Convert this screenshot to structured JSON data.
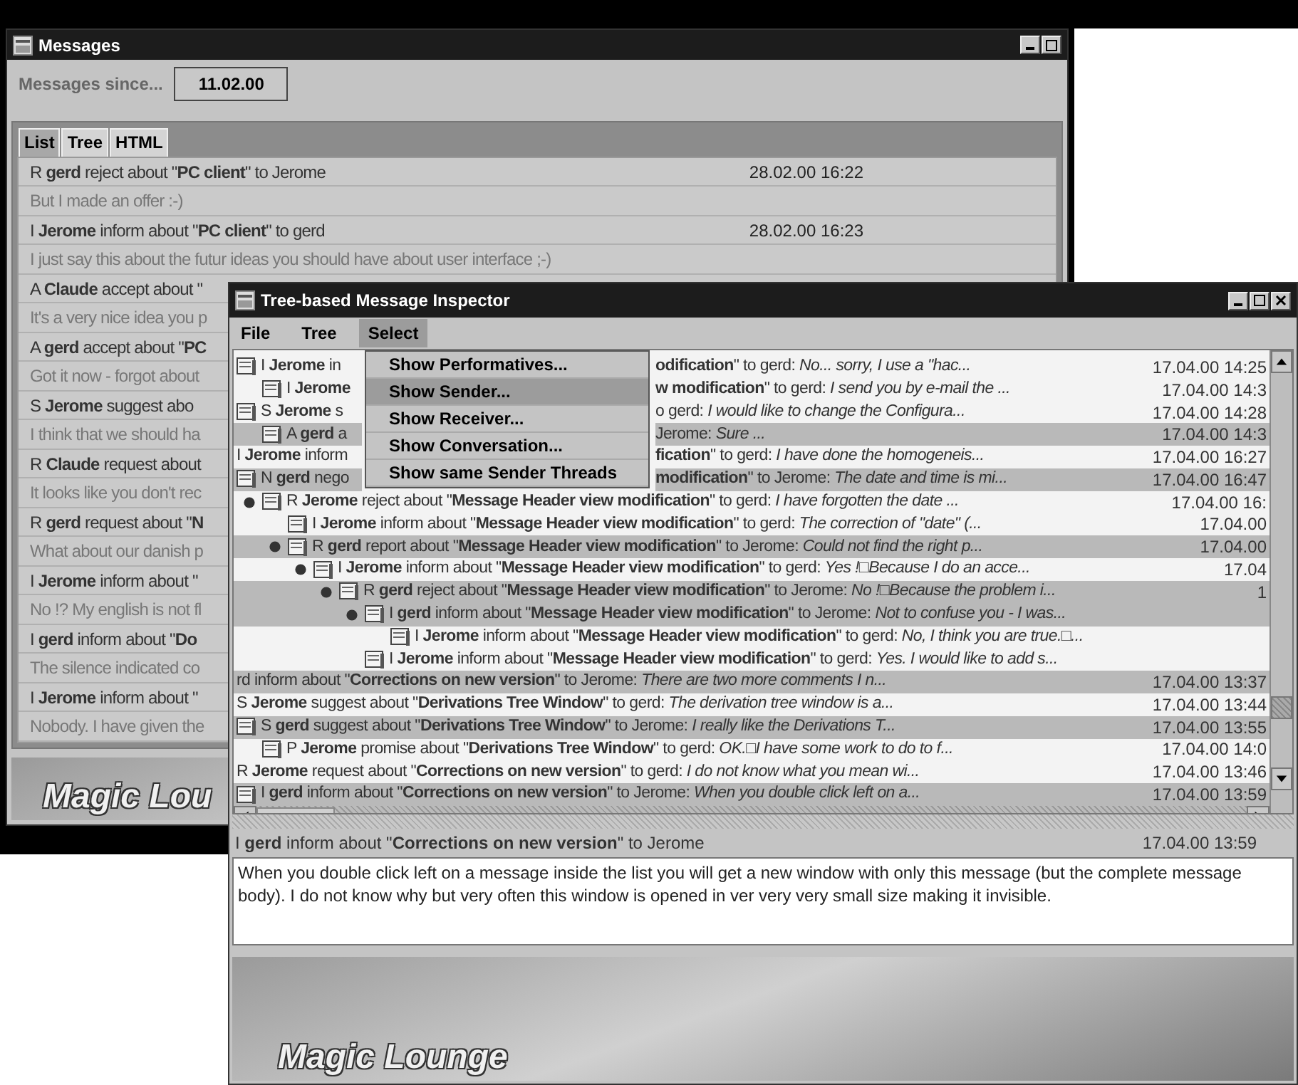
{
  "messages_window": {
    "title": "Messages",
    "since_label": "Messages since...",
    "since_value": "11.02.00",
    "tabs": [
      {
        "label": "List",
        "selected": true
      },
      {
        "label": "Tree",
        "selected": false
      },
      {
        "label": "HTML",
        "selected": false
      }
    ],
    "messages": [
      {
        "header": "R **gerd** reject about \"**PC client**\" to Jerome",
        "date": "28.02.00 16:22",
        "body": "But I made an offer :-)"
      },
      {
        "header": "I **Jerome** inform about \"**PC client**\" to gerd",
        "date": "28.02.00 16:23",
        "body": "I just say this about the futur ideas you should have about user interface ;-)"
      },
      {
        "header": "A **Claude** accept about \"",
        "body": "It's a very nice idea you p"
      },
      {
        "header": "A **gerd** accept about \"**PC**",
        "body": "Got it now - forgot about"
      },
      {
        "header": "S **Jerome** suggest abo",
        "body": "I think that we should ha"
      },
      {
        "header": "R **Claude** request about",
        "body": "It looks like you don't rec"
      },
      {
        "header": "R **gerd** request about \"**N**",
        "body": "What about our danish p"
      },
      {
        "header": "I **Jerome** inform about \"",
        "body": "No !? My english is not fl"
      },
      {
        "header": "I **gerd** inform about \"**Do**",
        "body": "The silence indicated co"
      },
      {
        "header": "I **Jerome** inform about \"",
        "body": "Nobody. I have given the"
      }
    ],
    "banner": "Magic Lou"
  },
  "inspector_window": {
    "title": "Tree-based Message Inspector",
    "menu": [
      {
        "label": "File",
        "selected": false
      },
      {
        "label": "Tree",
        "selected": false
      },
      {
        "label": "Select",
        "selected": true
      }
    ],
    "dropdown": [
      {
        "label": "Show Performatives...",
        "selected": false
      },
      {
        "label": "Show Sender...",
        "selected": true
      },
      {
        "label": "Show Receiver...",
        "selected": false
      },
      {
        "label": "Show Conversation...",
        "selected": false
      },
      {
        "label": "Show same Sender Threads",
        "selected": false
      }
    ],
    "tree": [
      {
        "text": "I **Jerome** in",
        "end": "**odification**\" to gerd: *No... sorry, I use a \"hac...*",
        "date": "17.04.00 14:25",
        "icon": true,
        "expanded": false,
        "highlighted": false,
        "children": [
          {
            "text": "I **Jerome**",
            "end": "**w modification**\" to gerd: *I send you by e-mail the ...*",
            "date": "17.04.00 14:3",
            "icon": true,
            "expanded": false,
            "highlighted": false
          }
        ]
      },
      {
        "text": "S **Jerome** s",
        "end": "o gerd: *I would like to change the Configura...*",
        "date": "17.04.00 14:28",
        "icon": true,
        "expanded": false,
        "highlighted": false,
        "children": [
          {
            "text": "A **gerd** a",
            "end": "Jerome: *Sure ...*",
            "date": "17.04.00 14:3",
            "icon": true,
            "expanded": false,
            "highlighted": true
          }
        ]
      },
      {
        "text": "I **Jerome** inform",
        "end": "**fication**\" to gerd: *I have done the homogeneis...*",
        "date": "17.04.00 16:27",
        "icon": false,
        "expanded": false,
        "highlighted": false
      },
      {
        "text": "N **gerd** nego",
        "end": "**modification**\" to Jerome: *The date and time is mi...*",
        "date": "17.04.00 16:47",
        "icon": true,
        "expanded": false,
        "highlighted": true,
        "children": [
          {
            "text": "R **Jerome** reject about \"**Message Header view modification**\" to gerd: *I have forgotten the date ...*",
            "date": "17.04.00 16:",
            "icon": true,
            "expanded": true,
            "highlighted": false,
            "children": [
              {
                "text": "I **Jerome** inform about \"**Message Header view modification**\" to gerd: *The correction of \"date\" (...*",
                "date": "17.04.00",
                "icon": true,
                "expanded": false,
                "highlighted": false
              },
              {
                "text": "R **gerd** report about \"**Message Header view modification**\" to Jerome: *Could not find the right p...*",
                "date": "17.04.00",
                "icon": true,
                "expanded": true,
                "highlighted": true,
                "children": [
                  {
                    "text": "I **Jerome** inform about \"**Message Header view modification**\" to gerd: *Yes !□Because I do an acce...*",
                    "date": "17.04",
                    "icon": true,
                    "expanded": true,
                    "highlighted": false,
                    "children": [
                      {
                        "text": "R **gerd** reject about \"**Message Header view modification**\" to Jerome: *No !□Because the problem i...*",
                        "date": "1",
                        "icon": true,
                        "expanded": true,
                        "highlighted": true,
                        "children": [
                          {
                            "text": "I **gerd** inform about \"**Message Header view modification**\" to Jerome: *Not to confuse you - I was...*",
                            "icon": true,
                            "expanded": true,
                            "highlighted": true,
                            "children": [
                              {
                                "text": "I **Jerome** inform about \"**Message Header view modification**\" to gerd: *No, I think you are true.□...*",
                                "icon": true,
                                "expanded": false,
                                "highlighted": false
                              }
                            ]
                          },
                          {
                            "text": "I **Jerome** inform about \"**Message Header view modification**\" to gerd: *Yes. I would like to add s...*",
                            "icon": true,
                            "expanded": false,
                            "highlighted": false
                          }
                        ]
                      }
                    ]
                  }
                ]
              }
            ]
          }
        ]
      },
      {
        "text": "rd inform about \"**Corrections on new version**\" to Jerome: *There are two more comments I n...*",
        "date": "17.04.00 13:37",
        "icon": false,
        "expanded": false,
        "highlighted": true
      },
      {
        "text": "S **Jerome** suggest about \"**Derivations Tree Window**\" to gerd: *The derivation tree window is a...*",
        "date": "17.04.00 13:44",
        "icon": false,
        "expanded": false,
        "highlighted": false
      },
      {
        "text": "S **gerd** suggest about \"**Derivations Tree Window**\" to Jerome: *I really like the Derivations T...*",
        "date": "17.04.00 13:55",
        "icon": true,
        "expanded": false,
        "highlighted": true,
        "children": [
          {
            "text": "P **Jerome** promise about \"**Derivations Tree Window**\" to gerd: *OK.□I have some work to do to f...*",
            "date": "17.04.00 14:0",
            "icon": true,
            "expanded": false,
            "highlighted": false
          }
        ]
      },
      {
        "text": "R **Jerome** request about \"**Corrections on new version**\" to gerd: *I do not know what you mean wi...*",
        "date": "17.04.00 13:46",
        "icon": false,
        "expanded": false,
        "highlighted": false
      },
      {
        "text": "I **gerd** inform about \"**Corrections on new version**\" to Jerome: *When you double click left on a...*",
        "date": "17.04.00 13:59",
        "icon": true,
        "expanded": false,
        "highlighted": true
      }
    ],
    "detail": {
      "header": "I **gerd** inform about \"**Corrections on new version**\" to Jerome",
      "date": "17.04.00 13:59",
      "body": "When you double click left on a message inside the list you will get a new window with only this message (but the complete message body). I do not know why but very often this window is opened in ver very very small size making it invisible."
    },
    "banner": "Magic Lounge"
  }
}
